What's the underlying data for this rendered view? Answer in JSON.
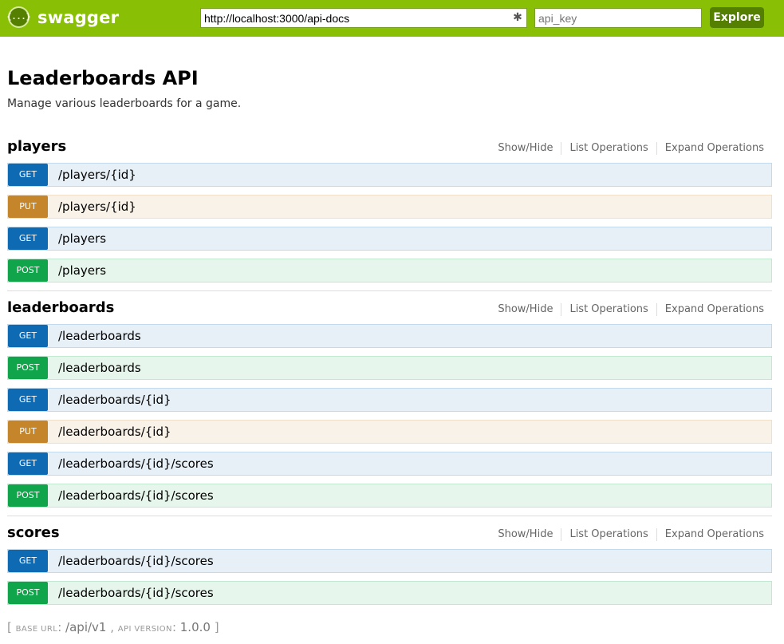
{
  "header": {
    "brand": "swagger",
    "logo_glyph": "{...}",
    "url_value": "http://localhost:3000/api-docs",
    "api_key_placeholder": "api_key",
    "explore_label": "Explore"
  },
  "info": {
    "title": "Leaderboards API",
    "description": "Manage various leaderboards for a game."
  },
  "resources": [
    {
      "name": "players",
      "links": [
        "Show/Hide",
        "List Operations",
        "Expand Operations"
      ],
      "operations": [
        {
          "method": "GET",
          "path": "/players/{id}"
        },
        {
          "method": "PUT",
          "path": "/players/{id}"
        },
        {
          "method": "GET",
          "path": "/players"
        },
        {
          "method": "POST",
          "path": "/players"
        }
      ]
    },
    {
      "name": "leaderboards",
      "links": [
        "Show/Hide",
        "List Operations",
        "Expand Operations"
      ],
      "operations": [
        {
          "method": "GET",
          "path": "/leaderboards"
        },
        {
          "method": "POST",
          "path": "/leaderboards"
        },
        {
          "method": "GET",
          "path": "/leaderboards/{id}"
        },
        {
          "method": "PUT",
          "path": "/leaderboards/{id}"
        },
        {
          "method": "GET",
          "path": "/leaderboards/{id}/scores"
        },
        {
          "method": "POST",
          "path": "/leaderboards/{id}/scores"
        }
      ]
    },
    {
      "name": "scores",
      "links": [
        "Show/Hide",
        "List Operations",
        "Expand Operations"
      ],
      "operations": [
        {
          "method": "GET",
          "path": "/leaderboards/{id}/scores"
        },
        {
          "method": "POST",
          "path": "/leaderboards/{id}/scores"
        }
      ]
    }
  ],
  "footer": {
    "open": "[ ",
    "base_url_label": "BASE URL",
    "base_url": "/api/v1",
    "sep": " , ",
    "api_version_label": "API VERSION",
    "api_version": "1.0.0",
    "close": " ]"
  },
  "colors": {
    "header_bg": "#89bf04",
    "get": "#0f6ab4",
    "put": "#c5862b",
    "post": "#10a54a"
  }
}
